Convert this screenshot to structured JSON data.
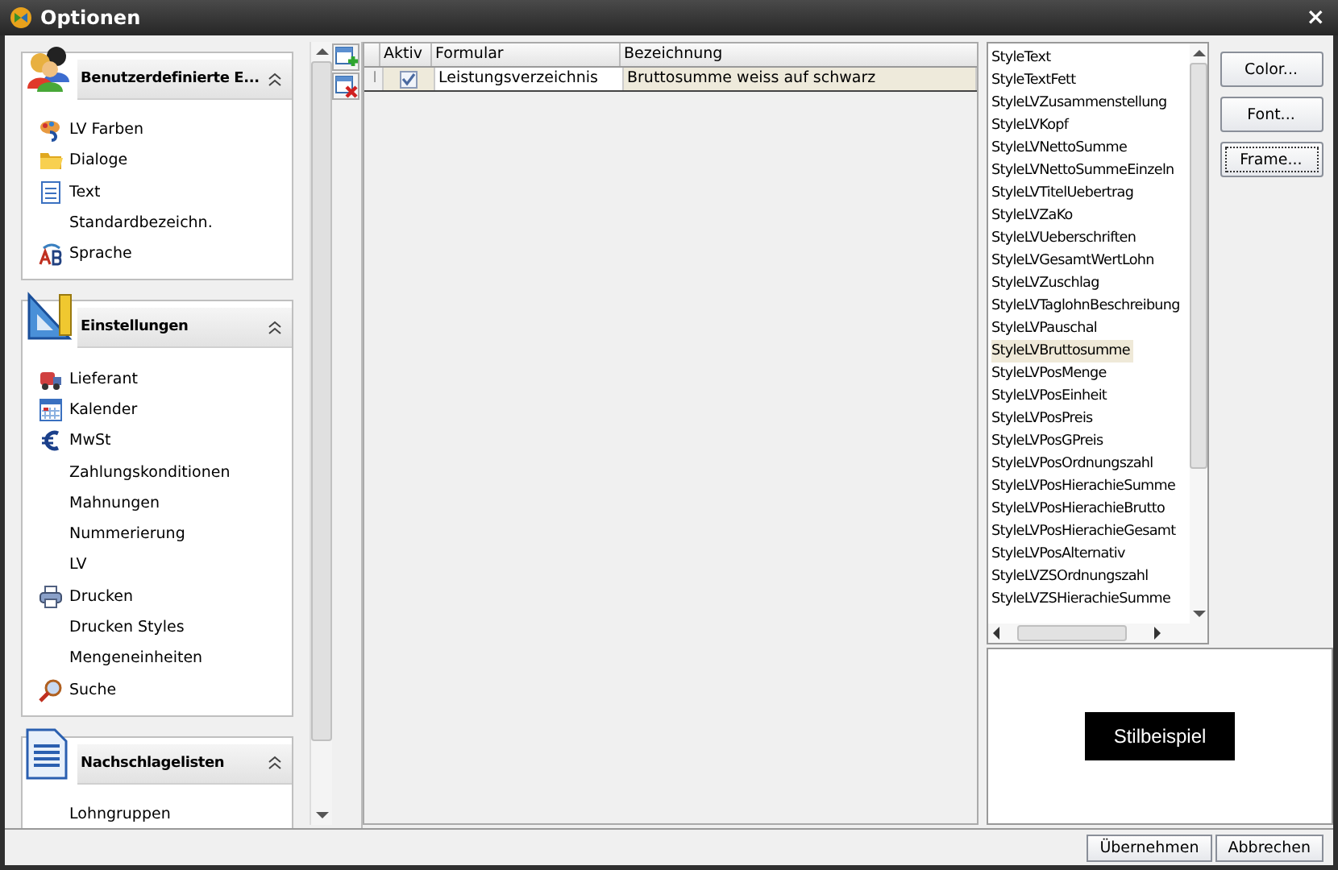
{
  "window": {
    "title": "Optionen",
    "close": "×"
  },
  "sidebar": {
    "groups": [
      {
        "title": "Benutzerdefinierte E...",
        "expanded": true,
        "items": [
          {
            "label": "LV Farben",
            "kind": "icon"
          },
          {
            "label": "Dialoge",
            "kind": "icon"
          },
          {
            "label": "Text",
            "kind": "icon"
          },
          {
            "label": "Standardbezeichn.",
            "kind": "plain"
          },
          {
            "label": "Sprache",
            "kind": "icon"
          }
        ]
      },
      {
        "title": "Einstellungen",
        "expanded": true,
        "items": [
          {
            "label": "Lieferant",
            "kind": "icon"
          },
          {
            "label": "Kalender",
            "kind": "icon"
          },
          {
            "label": "MwSt",
            "kind": "icon"
          },
          {
            "label": "Zahlungskonditionen",
            "kind": "plain"
          },
          {
            "label": "Mahnungen",
            "kind": "plain"
          },
          {
            "label": "Nummerierung",
            "kind": "plain"
          },
          {
            "label": "LV",
            "kind": "plain"
          },
          {
            "label": "Drucken",
            "kind": "icon"
          },
          {
            "label": "Drucken Styles",
            "kind": "plain"
          },
          {
            "label": "Mengeneinheiten",
            "kind": "plain"
          },
          {
            "label": "Suche",
            "kind": "icon"
          }
        ]
      },
      {
        "title": "Nachschlagelisten",
        "expanded": true,
        "items": [
          {
            "label": "Lohngruppen",
            "kind": "plain"
          }
        ]
      }
    ]
  },
  "grid": {
    "columns": [
      "Aktiv",
      "Formular",
      "Bezeichnung"
    ],
    "rows": [
      {
        "selected": true,
        "indicator": "I",
        "checked": true,
        "formular": "Leistungsverzeichnis",
        "bezeichnung": "Bruttosumme weiss auf schwarz"
      }
    ]
  },
  "styles": {
    "items": [
      {
        "label": "StyleText",
        "selected": false
      },
      {
        "label": "StyleTextFett",
        "selected": false
      },
      {
        "label": "StyleLVZusammenstellung",
        "selected": false
      },
      {
        "label": "StyleLVKopf",
        "selected": false
      },
      {
        "label": "StyleLVNettoSumme",
        "selected": false
      },
      {
        "label": "StyleLVNettoSummeEinzeln",
        "selected": false
      },
      {
        "label": "StyleLVTitelUebertrag",
        "selected": false
      },
      {
        "label": "StyleLVZaKo",
        "selected": false
      },
      {
        "label": "StyleLVUeberschriften",
        "selected": false
      },
      {
        "label": "StyleLVGesamtWertLohn",
        "selected": false
      },
      {
        "label": "StyleLVZuschlag",
        "selected": false
      },
      {
        "label": "StyleLVTaglohnBeschreibung",
        "selected": false
      },
      {
        "label": "StyleLVPauschal",
        "selected": false
      },
      {
        "label": "StyleLVBruttosumme",
        "selected": true
      },
      {
        "label": "StyleLVPosMenge",
        "selected": false
      },
      {
        "label": "StyleLVPosEinheit",
        "selected": false
      },
      {
        "label": "StyleLVPosPreis",
        "selected": false
      },
      {
        "label": "StyleLVPosGPreis",
        "selected": false
      },
      {
        "label": "StyleLVPosOrdnungszahl",
        "selected": false
      },
      {
        "label": "StyleLVPosHierachieSumme",
        "selected": false
      },
      {
        "label": "StyleLVPosHierachieBrutto",
        "selected": false
      },
      {
        "label": "StyleLVPosHierachieGesamt",
        "selected": false
      },
      {
        "label": "StyleLVPosAlternativ",
        "selected": false
      },
      {
        "label": "StyleLVZSOrdnungszahl",
        "selected": false
      },
      {
        "label": "StyleLVZSHierachieSumme",
        "selected": false
      }
    ],
    "buttons": [
      {
        "label": "Color...",
        "focused": false
      },
      {
        "label": "Font...",
        "focused": false
      },
      {
        "label": "Frame...",
        "focused": true
      }
    ],
    "preview": "Stilbeispiel"
  },
  "footer": {
    "buttons": [
      "Übernehmen",
      "Abbrechen"
    ]
  }
}
